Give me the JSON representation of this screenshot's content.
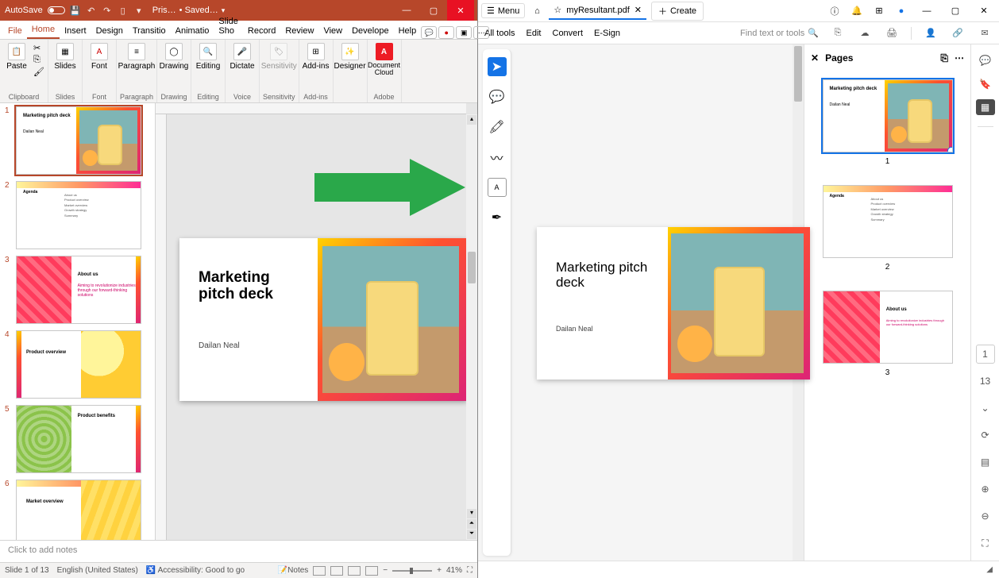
{
  "powerpoint": {
    "titlebar": {
      "autosave_label": "AutoSave",
      "doc_short": "Pris…",
      "save_state": "• Saved…"
    },
    "tabs": [
      "File",
      "Home",
      "Insert",
      "Design",
      "Transitio",
      "Animatio",
      "Slide Sho",
      "Record",
      "Review",
      "View",
      "Develope",
      "Help"
    ],
    "active_tab": "Home",
    "ribbon_groups": [
      {
        "label": "Clipboard",
        "items": [
          {
            "label": "Paste"
          }
        ]
      },
      {
        "label": "Slides",
        "items": [
          {
            "label": "Slides"
          }
        ]
      },
      {
        "label": "Font",
        "items": [
          {
            "label": "Font"
          }
        ]
      },
      {
        "label": "Paragraph",
        "items": [
          {
            "label": "Paragraph"
          }
        ]
      },
      {
        "label": "Drawing",
        "items": [
          {
            "label": "Drawing"
          }
        ]
      },
      {
        "label": "Editing",
        "items": [
          {
            "label": "Editing"
          }
        ]
      },
      {
        "label": "Voice",
        "items": [
          {
            "label": "Dictate"
          }
        ]
      },
      {
        "label": "Sensitivity",
        "items": [
          {
            "label": "Sensitivity"
          }
        ]
      },
      {
        "label": "Add-ins",
        "items": [
          {
            "label": "Add-ins"
          }
        ]
      },
      {
        "label": "",
        "items": [
          {
            "label": "Designer"
          }
        ]
      },
      {
        "label": "Adobe",
        "items": [
          {
            "label": "Document Cloud"
          }
        ]
      }
    ],
    "thumbs": [
      {
        "n": "1",
        "title": "Marketing pitch deck",
        "sub": "Dailan Neal",
        "layout": "title"
      },
      {
        "n": "2",
        "title": "Agenda",
        "layout": "agenda",
        "items": [
          "About us",
          "Product overview",
          "Market overview",
          "Growth strategy",
          "Summary"
        ]
      },
      {
        "n": "3",
        "title": "About us",
        "layout": "about",
        "sub": "Aiming to revolutionize industries through our forward-thinking solutions"
      },
      {
        "n": "4",
        "title": "Product overview",
        "layout": "product"
      },
      {
        "n": "5",
        "title": "Product benefits",
        "layout": "benefits"
      },
      {
        "n": "6",
        "title": "Market overview",
        "layout": "market"
      }
    ],
    "slide": {
      "title": "Marketing pitch deck",
      "author": "Dailan Neal"
    },
    "notes_placeholder": "Click to add notes",
    "status": {
      "slide_of": "Slide 1 of 13",
      "lang": "English (United States)",
      "access": "Accessibility: Good to go",
      "notes_btn": "Notes",
      "zoom": "41%"
    }
  },
  "acrobat": {
    "titlebar": {
      "menu": "Menu",
      "tab": "myResultant.pdf",
      "create": "Create"
    },
    "toolbar": {
      "items": [
        "All tools",
        "Edit",
        "Convert",
        "E-Sign"
      ],
      "search_placeholder": "Find text or tools"
    },
    "page": {
      "title": "Marketing pitch deck",
      "author": "Dailan Neal"
    },
    "pages_panel": {
      "title": "Pages",
      "thumbs": [
        {
          "n": "1",
          "title": "Marketing pitch deck",
          "sub": "Dailan Neal",
          "layout": "title"
        },
        {
          "n": "2",
          "title": "Agenda",
          "layout": "agenda",
          "items": [
            "About us",
            "Product overview",
            "Market overview",
            "Growth strategy",
            "Summary"
          ]
        },
        {
          "n": "3",
          "title": "About us",
          "layout": "about",
          "sub": "Aiming to revolutionize industries through our forward-thinking solutions"
        }
      ]
    },
    "rightrail_page_badge": "1",
    "rightrail_total": "13"
  }
}
